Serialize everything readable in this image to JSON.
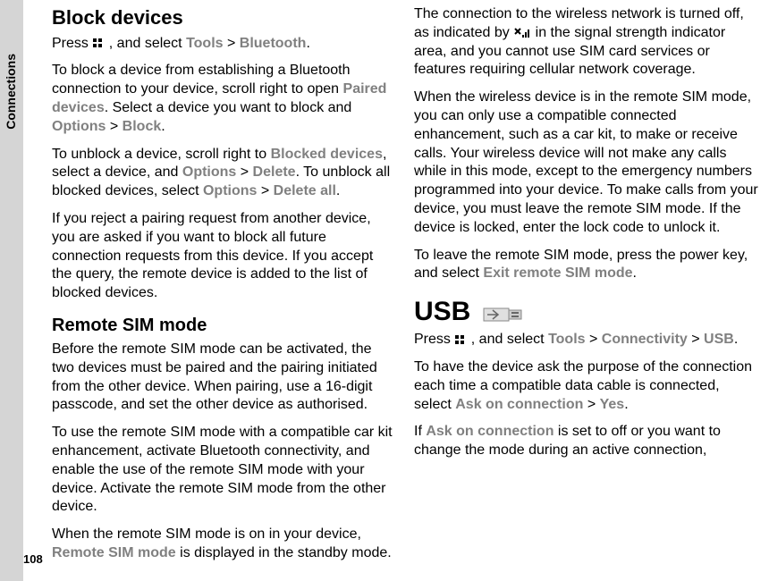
{
  "sidebar": {
    "label": "Connections",
    "page_number": "108"
  },
  "sections": {
    "block_devices": {
      "heading": "Block devices",
      "p1_a": "Press ",
      "p1_b": " , and select ",
      "p1_tools": "Tools",
      "p1_gt1": " > ",
      "p1_bluetooth": "Bluetooth",
      "p1_end": ".",
      "p2_a": "To block a device from establishing a Bluetooth connection to your device, scroll right to open ",
      "p2_paired": "Paired devices",
      "p2_b": ". Select a device you want to block and ",
      "p2_options": "Options",
      "p2_gt": " > ",
      "p2_block": "Block",
      "p2_end": ".",
      "p3_a": "To unblock a device, scroll right to ",
      "p3_blocked": "Blocked devices",
      "p3_b": ", select a device, and ",
      "p3_options1": "Options",
      "p3_gt1": " > ",
      "p3_delete": "Delete",
      "p3_c": ". To unblock all blocked devices, select ",
      "p3_options2": "Options",
      "p3_gt2": " > ",
      "p3_deleteall": "Delete all",
      "p3_end": ".",
      "p4": "If you reject a pairing request from another device, you are asked if you want to block all future connection requests from this device. If you accept the query, the remote device is added to the list of blocked devices."
    },
    "remote_sim": {
      "heading": "Remote SIM mode",
      "p1": "Before the remote SIM mode can be activated, the two devices must be paired and the pairing initiated from the other device. When pairing, use a 16-digit passcode, and set the other device as authorised.",
      "p2": "To use the remote SIM mode with a compatible car kit enhancement, activate Bluetooth connectivity, and enable the use of the remote SIM mode with your device. Activate the remote SIM mode from the other device.",
      "p3_a": "When the remote SIM mode is on in your device, ",
      "p3_rsm": "Remote SIM mode",
      "p3_b": " is displayed in the standby mode. The connection to the wireless network is turned off, as indicated by ",
      "p3_c": " in the signal strength indicator area, and you cannot use SIM card services or features requiring cellular network coverage.",
      "p4": "When the wireless device is in the remote SIM mode, you can only use a compatible connected enhancement, such as a car kit, to make or receive calls. Your wireless device will not make any calls while in this mode, except to the emergency numbers programmed into your device. To make calls from your device, you must leave the remote SIM mode. If the device is locked, enter the lock code to unlock it.",
      "p5_a": "To leave the remote SIM mode, press the power key, and select ",
      "p5_exit": "Exit remote SIM mode",
      "p5_end": "."
    },
    "usb": {
      "heading": "USB",
      "p1_a": "Press ",
      "p1_b": " , and select ",
      "p1_tools": "Tools",
      "p1_gt1": " > ",
      "p1_conn": "Connectivity",
      "p1_gt2": " > ",
      "p1_usb": "USB",
      "p1_end": ".",
      "p2_a": "To have the device ask the purpose of the connection each time a compatible data cable is connected, select ",
      "p2_ask": "Ask on connection",
      "p2_gt": " > ",
      "p2_yes": "Yes",
      "p2_end": ".",
      "p3_a": "If ",
      "p3_ask": "Ask on connection",
      "p3_b": " is set to off or you want to change the mode during an active connection,"
    }
  }
}
